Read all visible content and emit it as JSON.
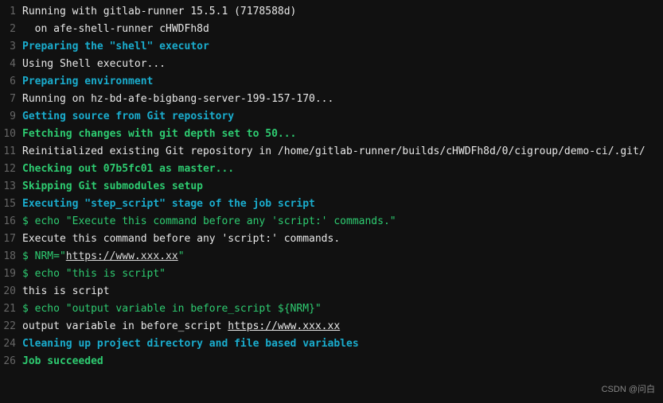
{
  "watermark": "CSDN @问白",
  "lines": [
    {
      "num": "1",
      "segs": [
        {
          "t": "Running with gitlab-runner 15.5.1 (7178588d)",
          "cls": "c-white"
        }
      ]
    },
    {
      "num": "2",
      "segs": [
        {
          "t": "  on afe-shell-runner cHWDFh8d",
          "cls": "c-white"
        }
      ]
    },
    {
      "num": "3",
      "segs": [
        {
          "t": "Preparing the \"shell\" executor",
          "cls": "c-cyan"
        }
      ]
    },
    {
      "num": "4",
      "segs": [
        {
          "t": "Using Shell executor...",
          "cls": "c-white"
        }
      ]
    },
    {
      "num": "6",
      "segs": [
        {
          "t": "Preparing environment",
          "cls": "c-cyan"
        }
      ]
    },
    {
      "num": "7",
      "segs": [
        {
          "t": "Running on hz-bd-afe-bigbang-server-199-157-170...",
          "cls": "c-white"
        }
      ]
    },
    {
      "num": "9",
      "segs": [
        {
          "t": "Getting source from Git repository",
          "cls": "c-cyan"
        }
      ]
    },
    {
      "num": "10",
      "segs": [
        {
          "t": "Fetching changes with git depth set to 50...",
          "cls": "c-green"
        }
      ]
    },
    {
      "num": "11",
      "segs": [
        {
          "t": "Reinitialized existing Git repository in /home/gitlab-runner/builds/cHWDFh8d/0/cigroup/demo-ci/.git/",
          "cls": "c-white"
        }
      ]
    },
    {
      "num": "12",
      "segs": [
        {
          "t": "Checking out 07b5fc01 as master...",
          "cls": "c-green"
        }
      ]
    },
    {
      "num": "13",
      "segs": [
        {
          "t": "Skipping Git submodules setup",
          "cls": "c-green"
        }
      ]
    },
    {
      "num": "15",
      "segs": [
        {
          "t": "Executing \"step_script\" stage of the job script",
          "cls": "c-cyan"
        }
      ]
    },
    {
      "num": "16",
      "segs": [
        {
          "t": "$ echo \"Execute this command before any 'script:' commands.\"",
          "cls": "c-green-cmd"
        }
      ]
    },
    {
      "num": "17",
      "segs": [
        {
          "t": "Execute this command before any 'script:' commands.",
          "cls": "c-white"
        }
      ]
    },
    {
      "num": "18",
      "segs": [
        {
          "t": "$ NRM=\"",
          "cls": "c-green-cmd"
        },
        {
          "t": "https://www.xxx.xx",
          "cls": "c-green-cmd link"
        },
        {
          "t": "\"",
          "cls": "c-green-cmd"
        }
      ]
    },
    {
      "num": "19",
      "segs": [
        {
          "t": "$ echo \"this is script\"",
          "cls": "c-green-cmd"
        }
      ]
    },
    {
      "num": "20",
      "segs": [
        {
          "t": "this is script",
          "cls": "c-white"
        }
      ]
    },
    {
      "num": "21",
      "segs": [
        {
          "t": "$ echo \"output variable in before_script ${NRM}\"",
          "cls": "c-green-cmd"
        }
      ]
    },
    {
      "num": "22",
      "segs": [
        {
          "t": "output variable in before_script ",
          "cls": "c-white"
        },
        {
          "t": "https://www.xxx.xx",
          "cls": "c-white link-white"
        }
      ]
    },
    {
      "num": "24",
      "segs": [
        {
          "t": "Cleaning up project directory and file based variables",
          "cls": "c-cyan"
        }
      ]
    },
    {
      "num": "26",
      "segs": [
        {
          "t": "Job succeeded",
          "cls": "c-green"
        }
      ]
    }
  ]
}
